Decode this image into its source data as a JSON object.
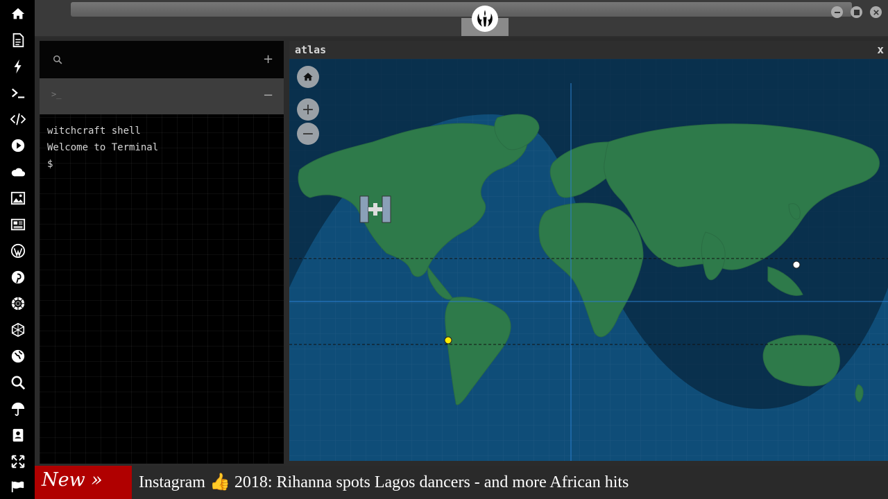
{
  "sidebar": {
    "items": [
      {
        "icon": "home-icon"
      },
      {
        "icon": "document-icon"
      },
      {
        "icon": "lightning-icon"
      },
      {
        "icon": "terminal-icon"
      },
      {
        "icon": "code-icon"
      },
      {
        "icon": "play-icon"
      },
      {
        "icon": "cloud-icon"
      },
      {
        "icon": "image-icon"
      },
      {
        "icon": "newspaper-icon"
      },
      {
        "icon": "wordpress-icon"
      },
      {
        "icon": "pinterest-icon"
      },
      {
        "icon": "empire-icon"
      },
      {
        "icon": "globe-mesh-icon"
      },
      {
        "icon": "globe-icon"
      },
      {
        "icon": "search-icon"
      },
      {
        "icon": "umbrella-icon"
      },
      {
        "icon": "contacts-icon"
      },
      {
        "icon": "expand-icon"
      },
      {
        "icon": "flag-icon"
      }
    ]
  },
  "topbar": {
    "logo": "rebel-alliance-icon"
  },
  "left_panel": {
    "search_icon": "⌕",
    "add_label": "+",
    "shell_tab_label": ">_",
    "collapse_label": "−"
  },
  "terminal": {
    "lines": [
      "witchcraft shell",
      "Welcome to Terminal"
    ],
    "prompt": "$"
  },
  "atlas": {
    "title": "atlas",
    "close": "x",
    "zoom_in": "+",
    "zoom_out": "−"
  },
  "ticker": {
    "badge": "New »",
    "headline": "Instagram 👍 2018: Rihanna spots Lagos dancers - and more African hits"
  },
  "colors": {
    "ocean": "#0d3f64",
    "land": "#2e7a4a",
    "night": "#0a2438",
    "ticker_badge": "#b00000"
  }
}
